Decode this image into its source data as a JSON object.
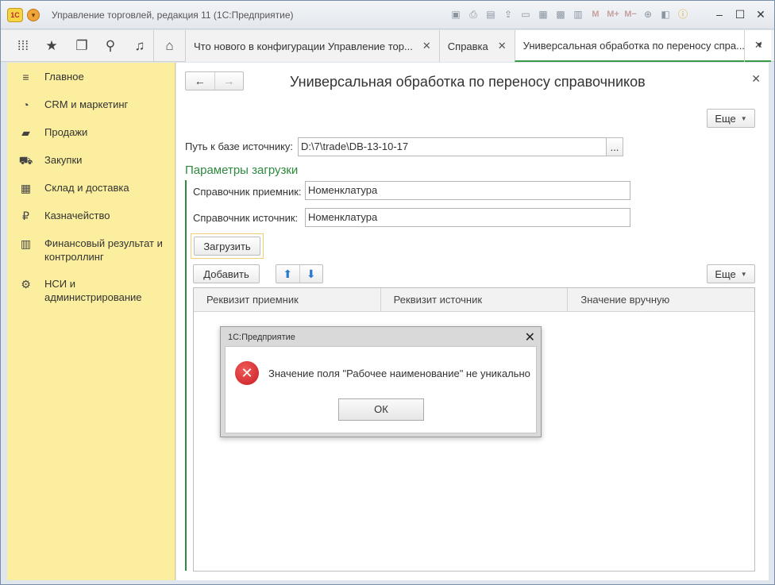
{
  "window": {
    "logo_text": "1С",
    "title": "Управление торговлей, редакция 11  (1С:Предприятие)",
    "menu_caret": "▾",
    "m_labels": [
      "M",
      "M+",
      "M−"
    ]
  },
  "navbar": {
    "icons": [
      "apps-icon",
      "star-icon",
      "history-icon",
      "search-icon",
      "bell-icon",
      "home-icon"
    ]
  },
  "tabs": [
    {
      "label": "Что нового в конфигурации Управление тор...",
      "close": "✕"
    },
    {
      "label": "Справка",
      "close": "✕"
    },
    {
      "label": "Универсальная обработка по переносу спра...",
      "close": "✕"
    }
  ],
  "sidebar": {
    "items": [
      {
        "label": "Главное",
        "icon": "≡"
      },
      {
        "label": "CRM и маркетинг",
        "icon": "◔"
      },
      {
        "label": "Продажи",
        "icon": "▰"
      },
      {
        "label": "Закупки",
        "icon": "⛟"
      },
      {
        "label": "Склад и доставка",
        "icon": "▦"
      },
      {
        "label": "Казначейство",
        "icon": "₽"
      },
      {
        "label": "Финансовый результат и контроллинг",
        "icon": "▥"
      },
      {
        "label": "НСИ и администрирование",
        "icon": "⚙"
      }
    ]
  },
  "form": {
    "title": "Универсальная обработка по переносу справочников",
    "more_label": "Еще",
    "source_path_label": "Путь к базе источнику:",
    "source_path_value": "D:\\7\\trade\\DB-13-10-17",
    "browse_label": "...",
    "section_title": "Параметры загрузки",
    "receiver_label": "Справочник приемник:",
    "receiver_value": "Номенклатура",
    "source_label": "Справочник источник:",
    "source_value": "Номенклатура",
    "load_label": "Загрузить",
    "add_label": "Добавить",
    "more2_label": "Еще",
    "columns": [
      "Реквизит приемник",
      "Реквизит источник",
      "Значение вручную"
    ]
  },
  "dialog": {
    "title": "1С:Предприятие",
    "message": "Значение поля \"Рабочее наименование\" не уникально",
    "ok_label": "ОК"
  },
  "colors": {
    "sidebar_bg": "#fbee9e",
    "section_accent": "#2d8a3e",
    "error_red": "#c61d22"
  }
}
